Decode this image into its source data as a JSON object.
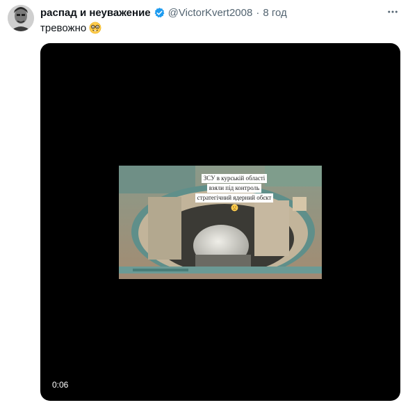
{
  "author": {
    "display_name": "распад и неуважение",
    "handle": "@VictorKvert2008",
    "separator": "·",
    "time": "8 год"
  },
  "tweet": {
    "text": "тревожно"
  },
  "video": {
    "caption_lines": [
      "ЗСУ в курській області",
      "взяли під контроль",
      "стратегічний ядерний обєкт"
    ],
    "timestamp": "0:06"
  },
  "icons": {
    "verified": "verified-badge-icon",
    "emoji": "nerd-face-emoji",
    "more": "more-options-icon"
  },
  "colors": {
    "verified_blue": "#1d9bf0",
    "muted_text": "#536471",
    "video_bg": "#000000"
  }
}
